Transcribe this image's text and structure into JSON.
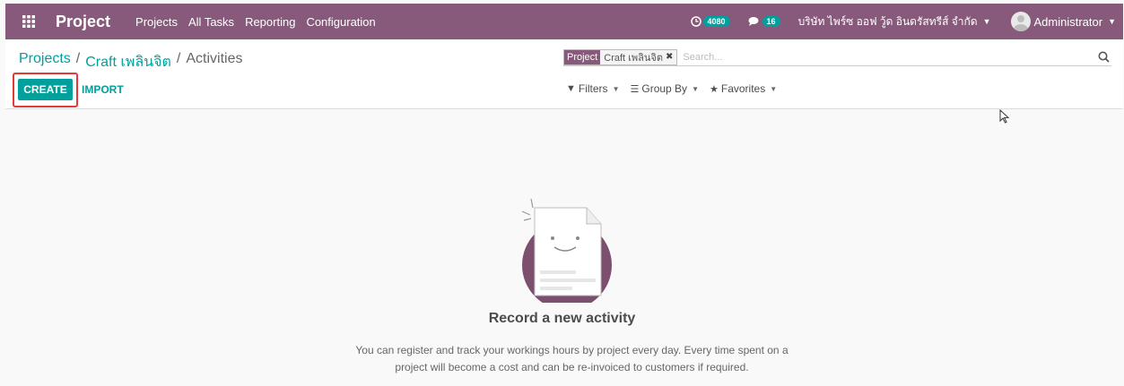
{
  "navbar": {
    "brand": "Project",
    "menu": [
      "Projects",
      "All Tasks",
      "Reporting",
      "Configuration"
    ],
    "activity_count": "4080",
    "message_count": "16",
    "company": "บริษัท ไพร์ซ ออฟ วู้ด อินดรัสทรีส์ จำกัด",
    "user": "Administrator",
    "accent_color": "#875a7b"
  },
  "breadcrumb": {
    "items": [
      "Projects",
      "Craft เพลินจิต"
    ],
    "current": "Activities",
    "separator": "/"
  },
  "buttons": {
    "create": "CREATE",
    "import": "IMPORT"
  },
  "search": {
    "facet_label": "Project",
    "facet_value": "Craft เพลินจิต",
    "placeholder": "Search..."
  },
  "filters": {
    "filters": "Filters",
    "group_by": "Group By",
    "favorites": "Favorites"
  },
  "empty_state": {
    "title": "Record a new activity",
    "line1": "You can register and track your workings hours by project every day. Every time spent on a",
    "line2": "project will become a cost and can be re-invoiced to customers if required."
  },
  "colors": {
    "primary": "#00a09d",
    "highlight": "#e53935"
  }
}
